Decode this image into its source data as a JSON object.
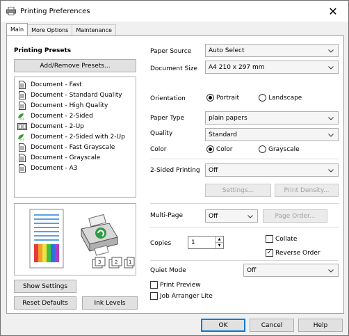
{
  "window": {
    "title": "Printing Preferences",
    "close": "✕"
  },
  "tabs": [
    {
      "label": "Main"
    },
    {
      "label": "More Options"
    },
    {
      "label": "Maintenance"
    }
  ],
  "presets": {
    "heading": "Printing Presets",
    "add_remove": "Add/Remove Presets...",
    "items": [
      {
        "label": "Document - Fast",
        "icon": "document-icon"
      },
      {
        "label": "Document - Standard Quality",
        "icon": "document-icon"
      },
      {
        "label": "Document - High Quality",
        "icon": "document-icon"
      },
      {
        "label": "Document - 2-Sided",
        "icon": "eco-icon"
      },
      {
        "label": "Document - 2-Up",
        "icon": "two-up-icon"
      },
      {
        "label": "Document - 2-Sided with 2-Up",
        "icon": "eco-icon"
      },
      {
        "label": "Document - Fast Grayscale",
        "icon": "document-icon"
      },
      {
        "label": "Document - Grayscale",
        "icon": "document-icon"
      },
      {
        "label": "Document - A3",
        "icon": "document-icon"
      }
    ]
  },
  "buttons": {
    "show_settings": "Show Settings",
    "reset_defaults": "Reset Defaults",
    "ink_levels": "Ink Levels"
  },
  "settings": {
    "paper_source": {
      "label": "Paper Source",
      "value": "Auto Select"
    },
    "document_size": {
      "label": "Document Size",
      "value": "A4 210 x 297 mm"
    },
    "orientation": {
      "label": "Orientation",
      "options": [
        "Portrait",
        "Landscape"
      ],
      "selected": "Portrait"
    },
    "paper_type": {
      "label": "Paper Type",
      "value": "plain papers"
    },
    "quality": {
      "label": "Quality",
      "value": "Standard"
    },
    "color": {
      "label": "Color",
      "options": [
        "Color",
        "Grayscale"
      ],
      "selected": "Color"
    },
    "two_sided": {
      "label": "2-Sided Printing",
      "value": "Off",
      "settings_btn": "Settings...",
      "density_btn": "Print Density..."
    },
    "multi_page": {
      "label": "Multi-Page",
      "value": "Off",
      "page_order_btn": "Page Order..."
    },
    "copies": {
      "label": "Copies",
      "value": "1"
    },
    "collate": {
      "label": "Collate",
      "checked": false
    },
    "reverse_order": {
      "label": "Reverse Order",
      "checked": true
    },
    "quiet_mode": {
      "label": "Quiet Mode",
      "value": "Off"
    },
    "print_preview": {
      "label": "Print Preview",
      "checked": false
    },
    "job_arranger": {
      "label": "Job Arranger Lite",
      "checked": false
    }
  },
  "footer": {
    "ok": "OK",
    "cancel": "Cancel",
    "help": "Help"
  },
  "colors": {
    "accent": "#0078d7",
    "eco_green": "#3a9a3a",
    "printer_green": "#2f9e44"
  }
}
